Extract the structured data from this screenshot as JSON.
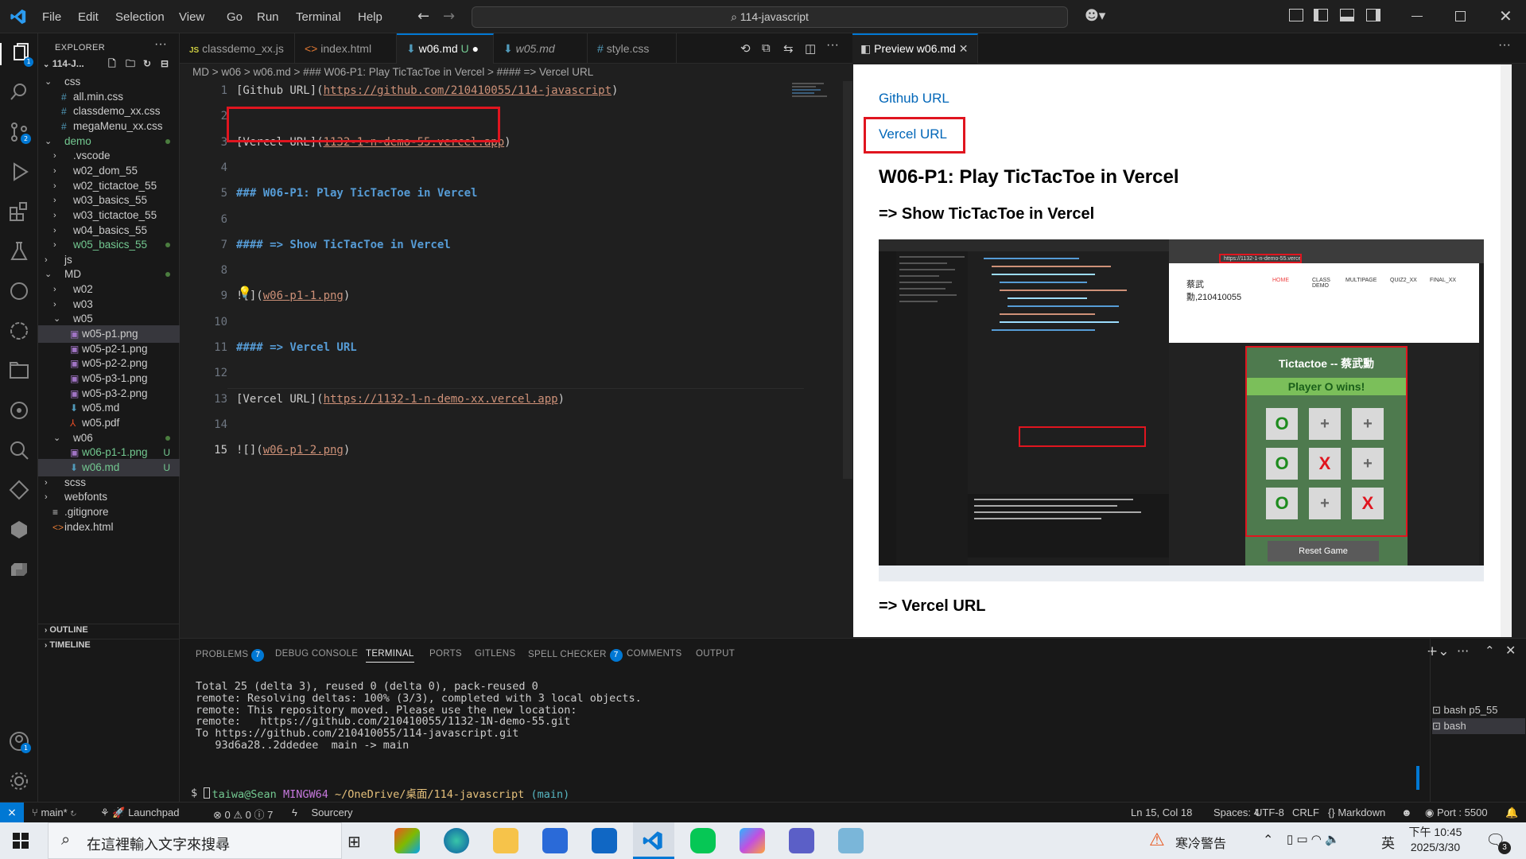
{
  "titlebar": {
    "menus": [
      "File",
      "Edit",
      "Selection",
      "View",
      "Go",
      "Run",
      "Terminal",
      "Help"
    ],
    "search": "114-javascript"
  },
  "explorer": {
    "title": "EXPLORER",
    "root": "114-J...",
    "rows": [
      {
        "label": "css",
        "type": "folder-open",
        "indent": 0
      },
      {
        "label": "all.min.css",
        "type": "css",
        "indent": 1
      },
      {
        "label": "classdemo_xx.css",
        "type": "css",
        "indent": 1
      },
      {
        "label": "megaMenu_xx.css",
        "type": "css",
        "indent": 1
      },
      {
        "label": "demo",
        "type": "folder-open",
        "indent": 0,
        "status": "dot"
      },
      {
        "label": ".vscode",
        "type": "folder",
        "indent": 1
      },
      {
        "label": "w02_dom_55",
        "type": "folder",
        "indent": 1
      },
      {
        "label": "w02_tictactoe_55",
        "type": "folder",
        "indent": 1
      },
      {
        "label": "w03_basics_55",
        "type": "folder",
        "indent": 1
      },
      {
        "label": "w03_tictactoe_55",
        "type": "folder",
        "indent": 1
      },
      {
        "label": "w04_basics_55",
        "type": "folder",
        "indent": 1
      },
      {
        "label": "w05_basics_55",
        "type": "folder",
        "indent": 1,
        "status": "dot"
      },
      {
        "label": "js",
        "type": "folder",
        "indent": 0
      },
      {
        "label": "MD",
        "type": "folder-open",
        "indent": 0,
        "status": "dot"
      },
      {
        "label": "w02",
        "type": "folder",
        "indent": 1
      },
      {
        "label": "w03",
        "type": "folder",
        "indent": 1
      },
      {
        "label": "w05",
        "type": "folder-open",
        "indent": 1
      },
      {
        "label": "w05-p1.png",
        "type": "png",
        "indent": 2,
        "selected": true
      },
      {
        "label": "w05-p2-1.png",
        "type": "png",
        "indent": 2
      },
      {
        "label": "w05-p2-2.png",
        "type": "png",
        "indent": 2
      },
      {
        "label": "w05-p3-1.png",
        "type": "png",
        "indent": 2
      },
      {
        "label": "w05-p3-2.png",
        "type": "png",
        "indent": 2
      },
      {
        "label": "w05.md",
        "type": "md",
        "indent": 2
      },
      {
        "label": "w05.pdf",
        "type": "pdf",
        "indent": 2
      },
      {
        "label": "w06",
        "type": "folder-open",
        "indent": 1,
        "status": "dot"
      },
      {
        "label": "w06-p1-1.png",
        "type": "png",
        "indent": 2,
        "status": "U"
      },
      {
        "label": "w06.md",
        "type": "md",
        "indent": 2,
        "status": "U",
        "active": true
      },
      {
        "label": "scss",
        "type": "folder",
        "indent": 0
      },
      {
        "label": "webfonts",
        "type": "folder",
        "indent": 0
      },
      {
        "label": ".gitignore",
        "type": "git",
        "indent": 0
      },
      {
        "label": "index.html",
        "type": "html",
        "indent": 0
      }
    ],
    "outline": "OUTLINE",
    "timeline": "TIMELINE"
  },
  "tabs": [
    {
      "label": "classdemo_xx.js",
      "icon": "JS"
    },
    {
      "label": "index.html",
      "icon": "<>"
    },
    {
      "label": "w06.md",
      "icon": "md",
      "active": true,
      "status": "U"
    },
    {
      "label": "w05.md",
      "icon": "md",
      "italic": true
    },
    {
      "label": "style.css",
      "icon": "#"
    }
  ],
  "breadcrumb": "MD > w06 > w06.md > ### W06-P1: Play TicTacToe in Vercel > #### => Vercel URL",
  "code_lines": [
    {
      "n": "1",
      "parts": [
        [
          "[Github URL](",
          "b"
        ],
        [
          "https://github.com/210410055/114-javascript",
          "l"
        ],
        [
          ")",
          "b"
        ]
      ]
    },
    {
      "n": "2",
      "parts": []
    },
    {
      "n": "3",
      "parts": [
        [
          "[Vercel URL](",
          "b"
        ],
        [
          "1132-1-n-demo-55.vercel.app",
          "l"
        ],
        [
          ")",
          "b"
        ]
      ]
    },
    {
      "n": "4",
      "parts": []
    },
    {
      "n": "5",
      "parts": [
        [
          "### W06-P1: Play TicTacToe in Vercel",
          "h"
        ]
      ]
    },
    {
      "n": "6",
      "parts": []
    },
    {
      "n": "7",
      "parts": [
        [
          "#### => Show TicTacToe in Vercel",
          "h"
        ]
      ]
    },
    {
      "n": "8",
      "parts": []
    },
    {
      "n": "9",
      "parts": [
        [
          "![](",
          "b"
        ],
        [
          "w06-p1-1.png",
          "l"
        ],
        [
          ")",
          "b"
        ]
      ]
    },
    {
      "n": "10",
      "parts": []
    },
    {
      "n": "11",
      "parts": [
        [
          "#### => Vercel URL",
          "h"
        ]
      ]
    },
    {
      "n": "12",
      "parts": []
    },
    {
      "n": "13",
      "parts": [
        [
          "[Vercel URL](",
          "b"
        ],
        [
          "https://1132-1-n-demo-xx.vercel.app",
          "l"
        ],
        [
          ")",
          "b"
        ]
      ]
    },
    {
      "n": "14",
      "parts": []
    },
    {
      "n": "15",
      "parts": [
        [
          "![](",
          "b"
        ],
        [
          "w06-p1-2.png",
          "l"
        ],
        [
          ")",
          "b"
        ]
      ]
    }
  ],
  "preview": {
    "tab": "Preview w06.md",
    "github_link": "Github URL",
    "vercel_link": "Vercel URL",
    "h3": "W06-P1: Play TicTacToe in Vercel",
    "h4": "=> Show TicTacToe in Vercel",
    "h4b": "=> Vercel URL",
    "embedded": {
      "url": "https://1132-1-n-demo-55.vercel.app/#",
      "site_name": "蔡武\n勳,210410055",
      "nav": [
        "HOME",
        "CLASS DEMO",
        "MULTIPAGE",
        "QUIZ2_XX",
        "FINAL_XX"
      ],
      "game_title": "Tictactoe -- 蔡武勳",
      "game_status": "Player O wins!",
      "board": [
        "O",
        "+",
        "+",
        "O",
        "X",
        "+",
        "O",
        "+",
        "X"
      ],
      "reset": "Reset Game"
    }
  },
  "panel": {
    "tabs": [
      {
        "label": "PROBLEMS",
        "badge": "7"
      },
      {
        "label": "DEBUG CONSOLE"
      },
      {
        "label": "TERMINAL",
        "active": true
      },
      {
        "label": "PORTS"
      },
      {
        "label": "GITLENS"
      },
      {
        "label": "SPELL CHECKER",
        "badge": "7"
      },
      {
        "label": "COMMENTS"
      },
      {
        "label": "OUTPUT"
      }
    ],
    "terminal_lines": [
      "Total 25 (delta 3), reused 0 (delta 0), pack-reused 0",
      "remote: Resolving deltas: 100% (3/3), completed with 3 local objects.",
      "remote: This repository moved. Please use the new location:",
      "remote:   https://github.com/210410055/1132-1N-demo-55.git",
      "To https://github.com/210410055/114-javascript.git",
      "   93d6a28..2ddedee  main -> main"
    ],
    "prompt_user": "taiwa@Sean",
    "prompt_host": "MINGW64",
    "prompt_path": "~/OneDrive/桌面/114-javascript",
    "prompt_branch": "(main)",
    "prompt_symbol": "$",
    "terminals": [
      "bash p5_55",
      "bash"
    ]
  },
  "statusbar": {
    "branch": "main*",
    "launchpad": "Launchpad",
    "problems": "⊗ 0 ⚠ 0 ⓘ 7",
    "sourcery": "Sourcery",
    "position": "Ln 15, Col 18",
    "spaces": "Spaces: 4",
    "encoding": "UTF-8",
    "eol": "CRLF",
    "language": "Markdown",
    "port": "Port : 5500"
  },
  "taskbar": {
    "search_placeholder": "在這裡輸入文字來搜尋",
    "weather": "寒冷警告",
    "ime": "英",
    "time": "下午 10:45",
    "date": "2025/3/30",
    "notification_count": "3"
  },
  "colors": {
    "accent": "#0078d4",
    "highlight_red": "#e0151f",
    "git_untracked": "#73c991",
    "link_preview": "#0066b8"
  }
}
